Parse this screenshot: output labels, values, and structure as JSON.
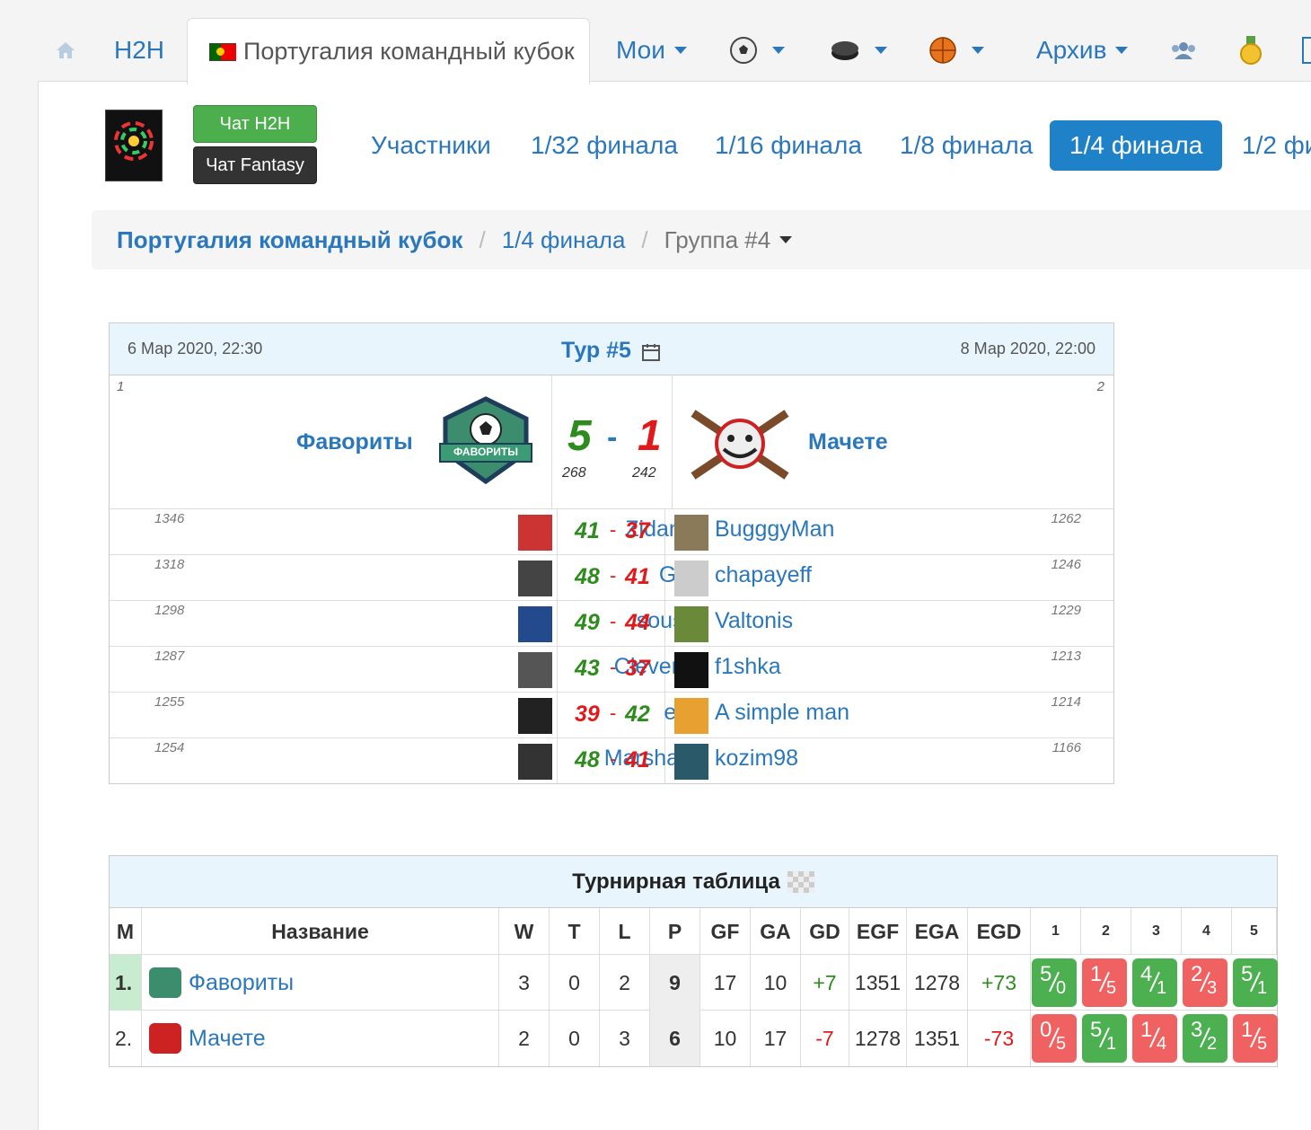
{
  "nav": {
    "h2h": "H2H",
    "active_tab": "Португалия командный кубок",
    "moi": "Мои",
    "archive": "Архив"
  },
  "chat": {
    "h2h": "Чат H2H",
    "fantasy": "Чат Fantasy"
  },
  "stages": [
    "Участники",
    "1/32 финала",
    "1/16 финала",
    "1/8 финала",
    "1/4 финала",
    "1/2 фи"
  ],
  "breadcrumb": {
    "cup": "Португалия командный кубок",
    "stage": "1/4 финала",
    "group": "Группа #4"
  },
  "match": {
    "date_left": "6 Мар 2020, 22:30",
    "tour": "Тур #5",
    "date_right": "8 Мар 2020, 22:00",
    "home": {
      "pos": "1",
      "name": "Фавориты",
      "score": "5",
      "pts": "268",
      "badge": "ФАВОРИТЫ"
    },
    "away": {
      "pos": "2",
      "name": "Мачете",
      "score": "1",
      "pts": "242"
    },
    "dash": "-",
    "pairs": [
      {
        "hr": "1346",
        "hn": "ZidaneZ",
        "hs": "41",
        "as": "37",
        "an": "BugggyMan",
        "ar": "1262",
        "win": "h"
      },
      {
        "hr": "1318",
        "hn": "GAD",
        "hs": "48",
        "as": "41",
        "an": "chapayeff",
        "ar": "1246",
        "win": "h"
      },
      {
        "hr": "1298",
        "hn": "sousse",
        "hs": "49",
        "as": "44",
        "an": "Valtonis",
        "ar": "1229",
        "win": "h"
      },
      {
        "hr": "1287",
        "hn": "Cleverley",
        "hs": "43",
        "as": "37",
        "an": "f1shka",
        "ar": "1213",
        "win": "h"
      },
      {
        "hr": "1255",
        "hn": "evar",
        "hs": "39",
        "as": "42",
        "an": "A simple man",
        "ar": "1214",
        "win": "a"
      },
      {
        "hr": "1254",
        "hn": "MarshallM",
        "hs": "48",
        "as": "41",
        "an": "kozim98",
        "ar": "1166",
        "win": "h"
      }
    ]
  },
  "standings": {
    "title": "Турнирная таблица",
    "headers": [
      "M",
      "Название",
      "W",
      "T",
      "L",
      "P",
      "GF",
      "GA",
      "GD",
      "EGF",
      "EGA",
      "EGD",
      "1",
      "2",
      "3",
      "4",
      "5"
    ],
    "rows": [
      {
        "pos": "1.",
        "name": "Фавориты",
        "w": "3",
        "t": "0",
        "l": "2",
        "p": "9",
        "gf": "17",
        "ga": "10",
        "gd": "+7",
        "egf": "1351",
        "ega": "1278",
        "egd": "+73",
        "results": [
          {
            "a": "5",
            "b": "0",
            "win": true
          },
          {
            "a": "1",
            "b": "5",
            "win": false
          },
          {
            "a": "4",
            "b": "1",
            "win": true
          },
          {
            "a": "2",
            "b": "3",
            "win": false
          },
          {
            "a": "5",
            "b": "1",
            "win": true
          }
        ]
      },
      {
        "pos": "2.",
        "name": "Мачете",
        "w": "2",
        "t": "0",
        "l": "3",
        "p": "6",
        "gf": "10",
        "ga": "17",
        "gd": "-7",
        "egf": "1278",
        "ega": "1351",
        "egd": "-73",
        "results": [
          {
            "a": "0",
            "b": "5",
            "win": false
          },
          {
            "a": "5",
            "b": "1",
            "win": true
          },
          {
            "a": "1",
            "b": "4",
            "win": false
          },
          {
            "a": "3",
            "b": "2",
            "win": true
          },
          {
            "a": "1",
            "b": "5",
            "win": false
          }
        ]
      }
    ]
  },
  "colors": {
    "link": "#2a77bc",
    "win": "#2e8b1e",
    "loss": "#e01a1a",
    "result_win": "#4caf50",
    "result_loss": "#f06262"
  }
}
